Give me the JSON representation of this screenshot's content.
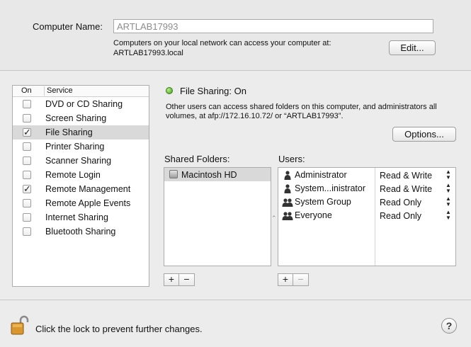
{
  "computer_name": {
    "label": "Computer Name:",
    "value": "ARTLAB17993",
    "description": "Computers on your local network can access your computer at:",
    "local_address": "ARTLAB17993.local",
    "edit_label": "Edit..."
  },
  "service_list": {
    "header_on": "On",
    "header_service": "Service",
    "items": [
      {
        "label": "DVD or CD Sharing",
        "checked": false,
        "selected": false
      },
      {
        "label": "Screen Sharing",
        "checked": false,
        "selected": false
      },
      {
        "label": "File Sharing",
        "checked": true,
        "selected": true
      },
      {
        "label": "Printer Sharing",
        "checked": false,
        "selected": false
      },
      {
        "label": "Scanner Sharing",
        "checked": false,
        "selected": false
      },
      {
        "label": "Remote Login",
        "checked": false,
        "selected": false
      },
      {
        "label": "Remote Management",
        "checked": true,
        "selected": false
      },
      {
        "label": "Remote Apple Events",
        "checked": false,
        "selected": false
      },
      {
        "label": "Internet Sharing",
        "checked": false,
        "selected": false
      },
      {
        "label": "Bluetooth Sharing",
        "checked": false,
        "selected": false
      }
    ]
  },
  "file_sharing": {
    "status": "File Sharing: On",
    "status_color": "#3f9b17",
    "description": "Other users can access shared folders on this computer, and administrators all volumes, at afp://172.16.10.72/ or “ARTLAB17993”.",
    "options_label": "Options..."
  },
  "shared_folders": {
    "label": "Shared Folders:",
    "items": [
      {
        "label": "Macintosh HD",
        "icon": "hard-drive-icon"
      }
    ]
  },
  "users": {
    "label": "Users:",
    "items": [
      {
        "name": "Administrator",
        "permission": "Read & Write",
        "icon": "single-user-icon"
      },
      {
        "name": "System...inistrator",
        "permission": "Read & Write",
        "icon": "single-user-icon"
      },
      {
        "name": "System Group",
        "permission": "Read Only",
        "icon": "group-icon"
      },
      {
        "name": "Everyone",
        "permission": "Read Only",
        "icon": "group-icon"
      }
    ]
  },
  "controls": {
    "add": "+",
    "remove": "−",
    "stepper": "▲▼"
  },
  "footer": {
    "lock_text": "Click the lock to prevent further changes.",
    "help": "?"
  }
}
